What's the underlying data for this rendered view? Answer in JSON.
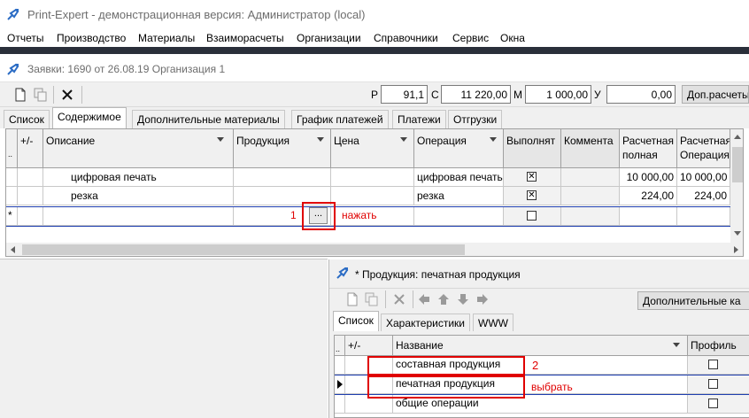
{
  "window": {
    "title": "Print-Expert - демонстрационная версия: Администратор (local)"
  },
  "menu": [
    "Отчеты",
    "Производство",
    "Материалы",
    "Взаиморасчеты",
    "Организации",
    "Справочники",
    "Сервис",
    "Окна"
  ],
  "child_window": {
    "title": "Заявки: 1690 от 26.08.19  Организация 1"
  },
  "summary": {
    "r_label": "Р",
    "r_value": "91,1",
    "c_label": "С",
    "c_value": "11 220,00",
    "m_label": "М",
    "m_value": "1 000,00",
    "u_label": "У",
    "u_value": "0,00",
    "extra_button": "Доп.расчеты"
  },
  "tabs": [
    "Список",
    "Содержимое",
    "Дополнительные материалы",
    "График платежей",
    "Платежи",
    "Отгрузки"
  ],
  "active_tab": "Содержимое",
  "grid": {
    "columns": [
      "+/-",
      "Описание",
      "Продукция",
      "Цена",
      "Операция",
      "Выполнят",
      "Коммента",
      "Расчетная полная",
      "Расчетная Операция"
    ],
    "rows": [
      {
        "description": "цифровая печать",
        "product": "",
        "price": "",
        "operation": "цифровая печать",
        "done": true,
        "comment": "",
        "calc_full": "10 000,00",
        "calc_op": "10 000,00"
      },
      {
        "description": "резка",
        "product": "",
        "price": "",
        "operation": "резка",
        "done": true,
        "comment": "",
        "calc_full": "224,00",
        "calc_op": "224,00"
      },
      {
        "description": "",
        "product": "",
        "price": "",
        "operation": "",
        "done": false,
        "comment": "",
        "calc_full": "",
        "calc_op": ""
      }
    ],
    "new_row_marker": "*",
    "ellipsis_button": "...",
    "annotation_number": "1",
    "annotation_text": "нажать"
  },
  "sub_window": {
    "title": "* Продукция: печатная продукция",
    "extra_button": "Дополнительные ка",
    "tabs": [
      "Список",
      "Характеристики",
      "WWW"
    ],
    "active_tab": "Список",
    "columns": [
      "+/-",
      "Название",
      "Профиль"
    ],
    "rows": [
      {
        "name": "составная продукция",
        "selected": false
      },
      {
        "name": "печатная продукция",
        "selected": true
      },
      {
        "name": "общие операции",
        "selected": false
      }
    ],
    "annotation_number": "2",
    "annotation_text": "выбрать"
  },
  "colors": {
    "annotation": "#e00000",
    "dark_strip": "#2a2f3a",
    "app_icon": "#2b6cc4"
  }
}
